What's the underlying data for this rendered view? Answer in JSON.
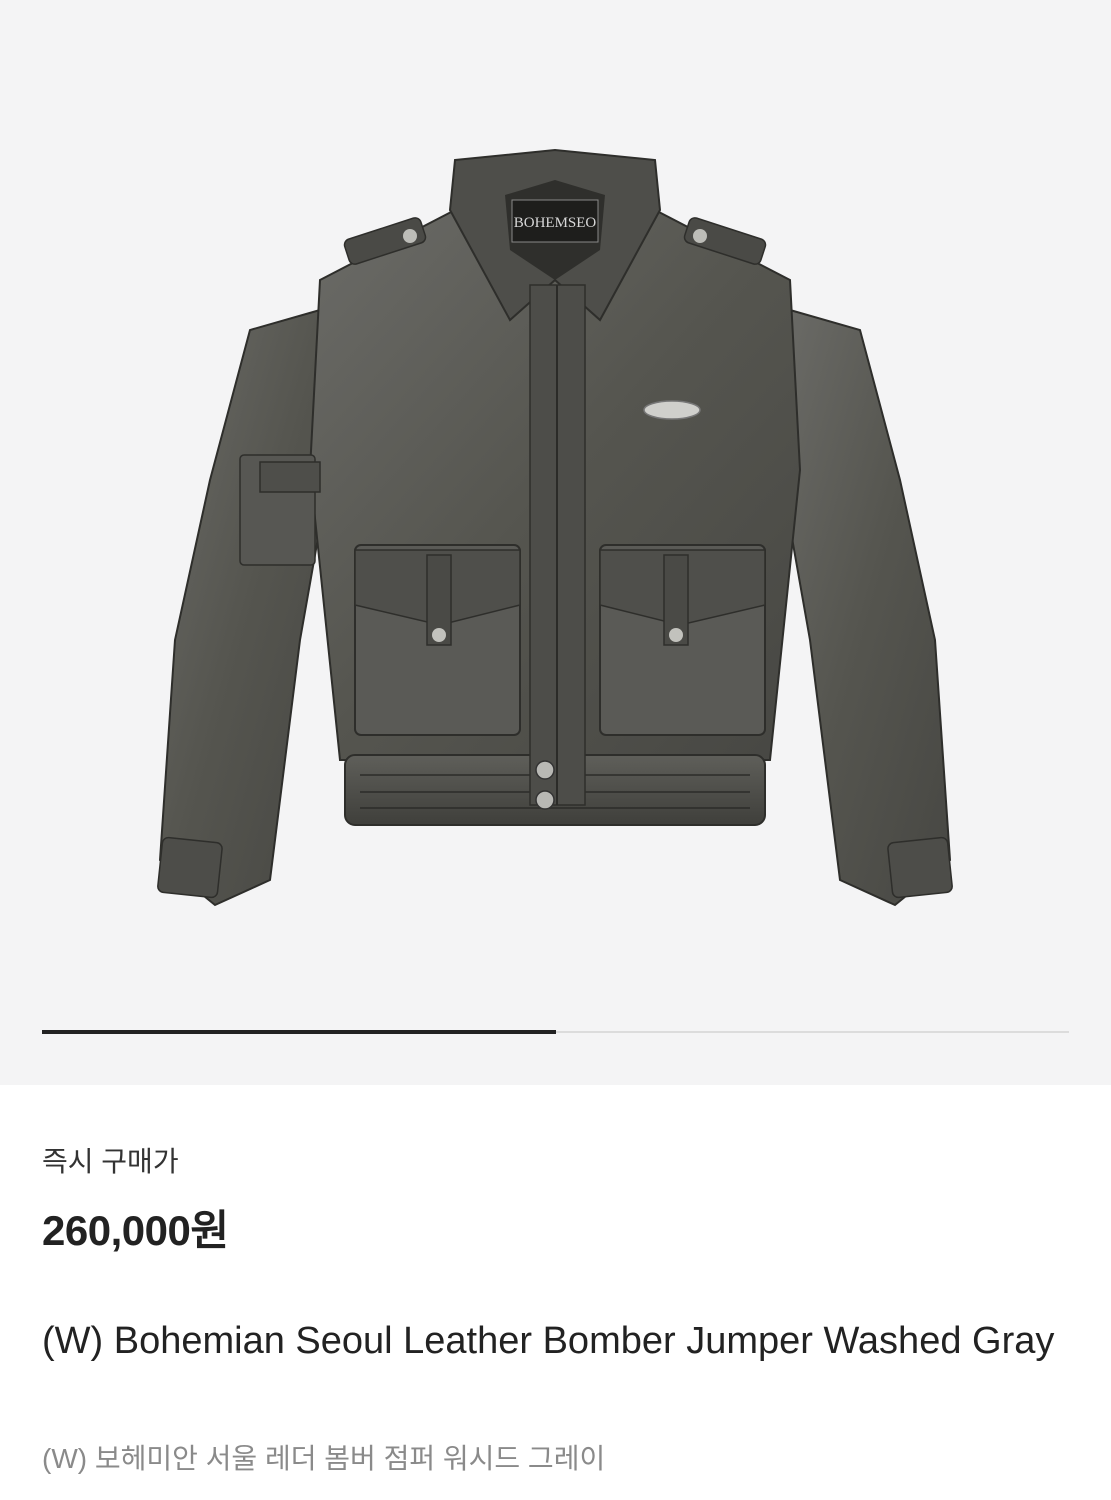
{
  "product": {
    "brand_tag": "BOHEMSEO",
    "price_label": "즉시 구매가",
    "price": "260,000원",
    "name_en": "(W) Bohemian Seoul Leather Bomber Jumper Washed Gray",
    "name_ko": "(W) 보헤미안 서울 레더 봄버 점퍼 워시드 그레이"
  },
  "carousel": {
    "progress": 0.5
  },
  "colors": {
    "hero_bg": "#f4f4f5",
    "jacket": "#5a5a57",
    "text_primary": "#222222",
    "text_secondary": "#8a8a8a"
  }
}
